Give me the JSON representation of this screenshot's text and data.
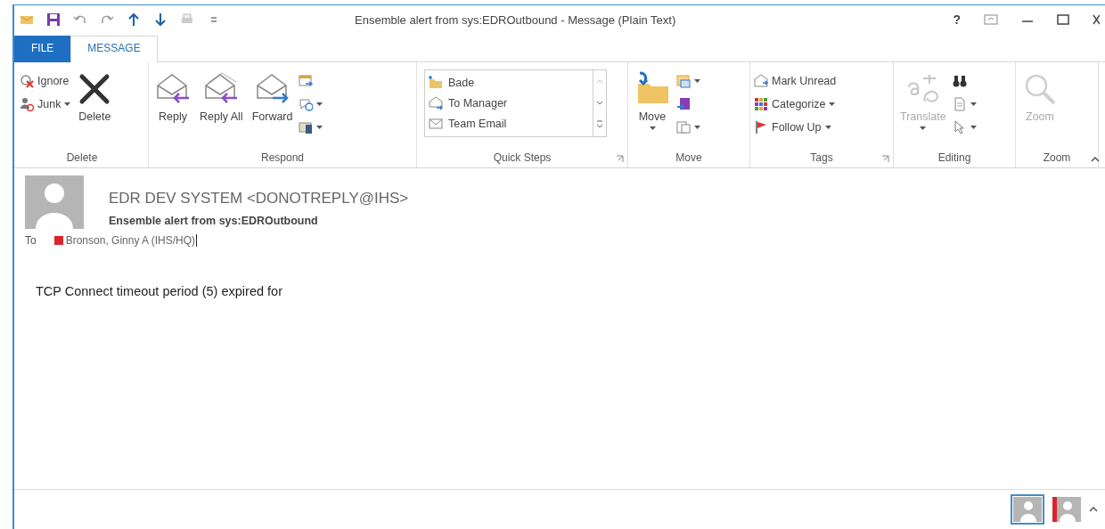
{
  "window": {
    "title": "Ensemble alert from sys:EDROutbound - Message (Plain Text)",
    "help": "?"
  },
  "tabs": [
    {
      "label": "FILE",
      "selected": false
    },
    {
      "label": "MESSAGE",
      "selected": true
    }
  ],
  "ribbon": {
    "groups": [
      {
        "name": "Delete",
        "launcher": false,
        "items": [
          {
            "kind": "stack",
            "buttons": [
              {
                "label": "Ignore",
                "dropdown": false,
                "disabled": false
              },
              {
                "label": "Junk",
                "dropdown": true,
                "disabled": false
              }
            ]
          },
          {
            "kind": "large",
            "label": "Delete",
            "dropdown": false,
            "disabled": false
          }
        ]
      },
      {
        "name": "Respond",
        "launcher": false,
        "items": [
          {
            "kind": "large",
            "label": "Reply",
            "dropdown": false,
            "disabled": false
          },
          {
            "kind": "large",
            "label": "Reply All",
            "dropdown": false,
            "disabled": false
          },
          {
            "kind": "large",
            "label": "Forward",
            "dropdown": false,
            "disabled": false
          },
          {
            "kind": "stack",
            "buttons": [
              {
                "dropdown": false,
                "disabled": false
              },
              {
                "dropdown": true,
                "disabled": false
              },
              {
                "dropdown": true,
                "disabled": false
              }
            ]
          }
        ]
      },
      {
        "name": "Quick Steps",
        "launcher": true,
        "items": [
          {
            "kind": "gallery",
            "entries": [
              "Bade",
              "To Manager",
              "Team Email"
            ]
          }
        ]
      },
      {
        "name": "Move",
        "launcher": false,
        "items": [
          {
            "kind": "large",
            "label": "Move",
            "dropdown": true,
            "disabled": false
          },
          {
            "kind": "stack",
            "buttons": [
              {
                "dropdown": true,
                "disabled": false
              },
              {
                "dropdown": false,
                "disabled": false
              },
              {
                "dropdown": true,
                "disabled": false
              }
            ]
          }
        ]
      },
      {
        "name": "Tags",
        "launcher": true,
        "items": [
          {
            "kind": "stack",
            "buttons": [
              {
                "label": "Mark Unread",
                "dropdown": false,
                "disabled": false
              },
              {
                "label": "Categorize",
                "dropdown": true,
                "disabled": false
              },
              {
                "label": "Follow Up",
                "dropdown": true,
                "disabled": false
              }
            ]
          }
        ]
      },
      {
        "name": "Editing",
        "launcher": false,
        "items": [
          {
            "kind": "large",
            "label": "Translate",
            "dropdown": true,
            "disabled": true
          },
          {
            "kind": "stack",
            "buttons": [
              {
                "dropdown": false,
                "disabled": false
              },
              {
                "dropdown": true,
                "disabled": false
              },
              {
                "dropdown": true,
                "disabled": false
              }
            ]
          }
        ]
      },
      {
        "name": "Zoom",
        "launcher": false,
        "items": [
          {
            "kind": "large",
            "label": "Zoom",
            "dropdown": false,
            "disabled": true
          }
        ]
      }
    ]
  },
  "header": {
    "sender": "EDR DEV SYSTEM <DONOTREPLY@IHS>",
    "subject": "Ensemble alert from sys:EDROutbound",
    "to_label": "To",
    "recipients": [
      "Bronson, Ginny A (IHS/HQ)"
    ]
  },
  "body": {
    "text": "TCP Connect timeout period (5) expired for"
  },
  "people_pane": {
    "contacts": [
      {
        "selected": true
      },
      {
        "selected": false
      }
    ]
  }
}
